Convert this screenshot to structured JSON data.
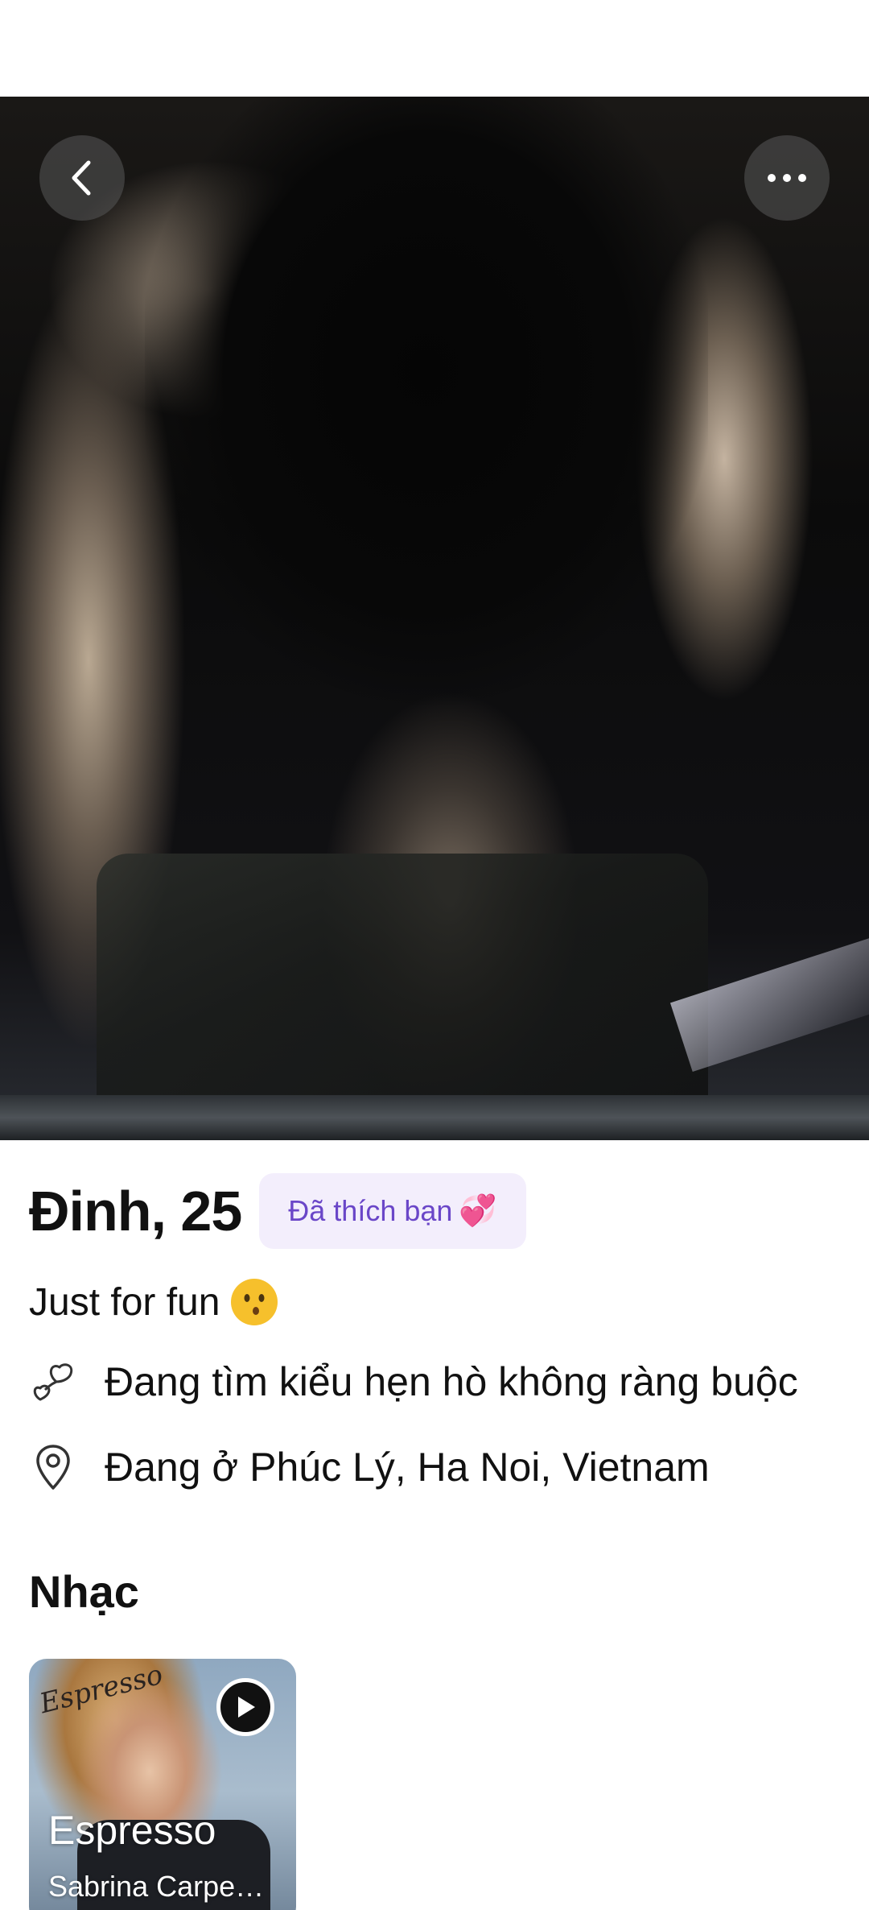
{
  "profile": {
    "name_age": "Đinh, 25",
    "liked_badge": "Đã thích bạn",
    "liked_badge_emoji": "💞",
    "bio": "Just for fun",
    "bio_emoji": "😗",
    "looking_for": "Đang tìm kiểu hẹn hò không ràng buộc",
    "location": "Đang ở Phúc Lý, Ha Noi, Vietnam"
  },
  "icons": {
    "back": "chevron-left-icon",
    "more": "more-horizontal-icon",
    "looking_for": "hearts-icon",
    "location": "map-pin-icon",
    "play": "play-icon"
  },
  "music": {
    "section_title": "Nhạc",
    "tracks": [
      {
        "title": "Espresso",
        "artist": "Sabrina Carpe…",
        "cover_script": "Espresso"
      }
    ]
  },
  "colors": {
    "badge_bg": "#f3eefc",
    "badge_text": "#6a46c8",
    "text": "#111111"
  }
}
